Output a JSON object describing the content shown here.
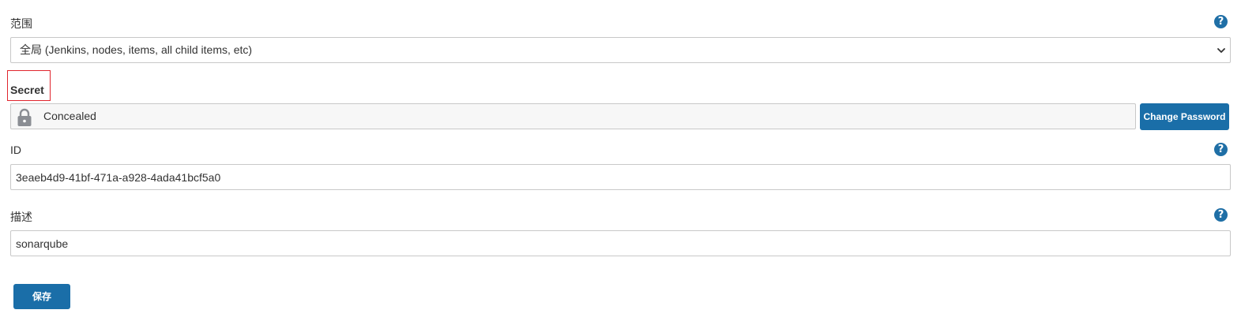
{
  "scope": {
    "label": "范围",
    "selected": "全局 (Jenkins, nodes, items, all child items, etc)"
  },
  "secret": {
    "label": "Secret",
    "value": "Concealed",
    "change_button": "Change Password"
  },
  "id": {
    "label": "ID",
    "value": "3eaeb4d9-41bf-471a-a928-4ada41bcf5a0"
  },
  "description": {
    "label": "描述",
    "value": "sonarqube"
  },
  "actions": {
    "save_label": "保存"
  },
  "help": {
    "glyph": "?"
  },
  "colors": {
    "accent": "#1a6ea8",
    "highlight": "#e0252d"
  },
  "icons": {
    "help": "help-icon",
    "lock": "lock-icon",
    "chevron": "chevron-down-icon"
  }
}
